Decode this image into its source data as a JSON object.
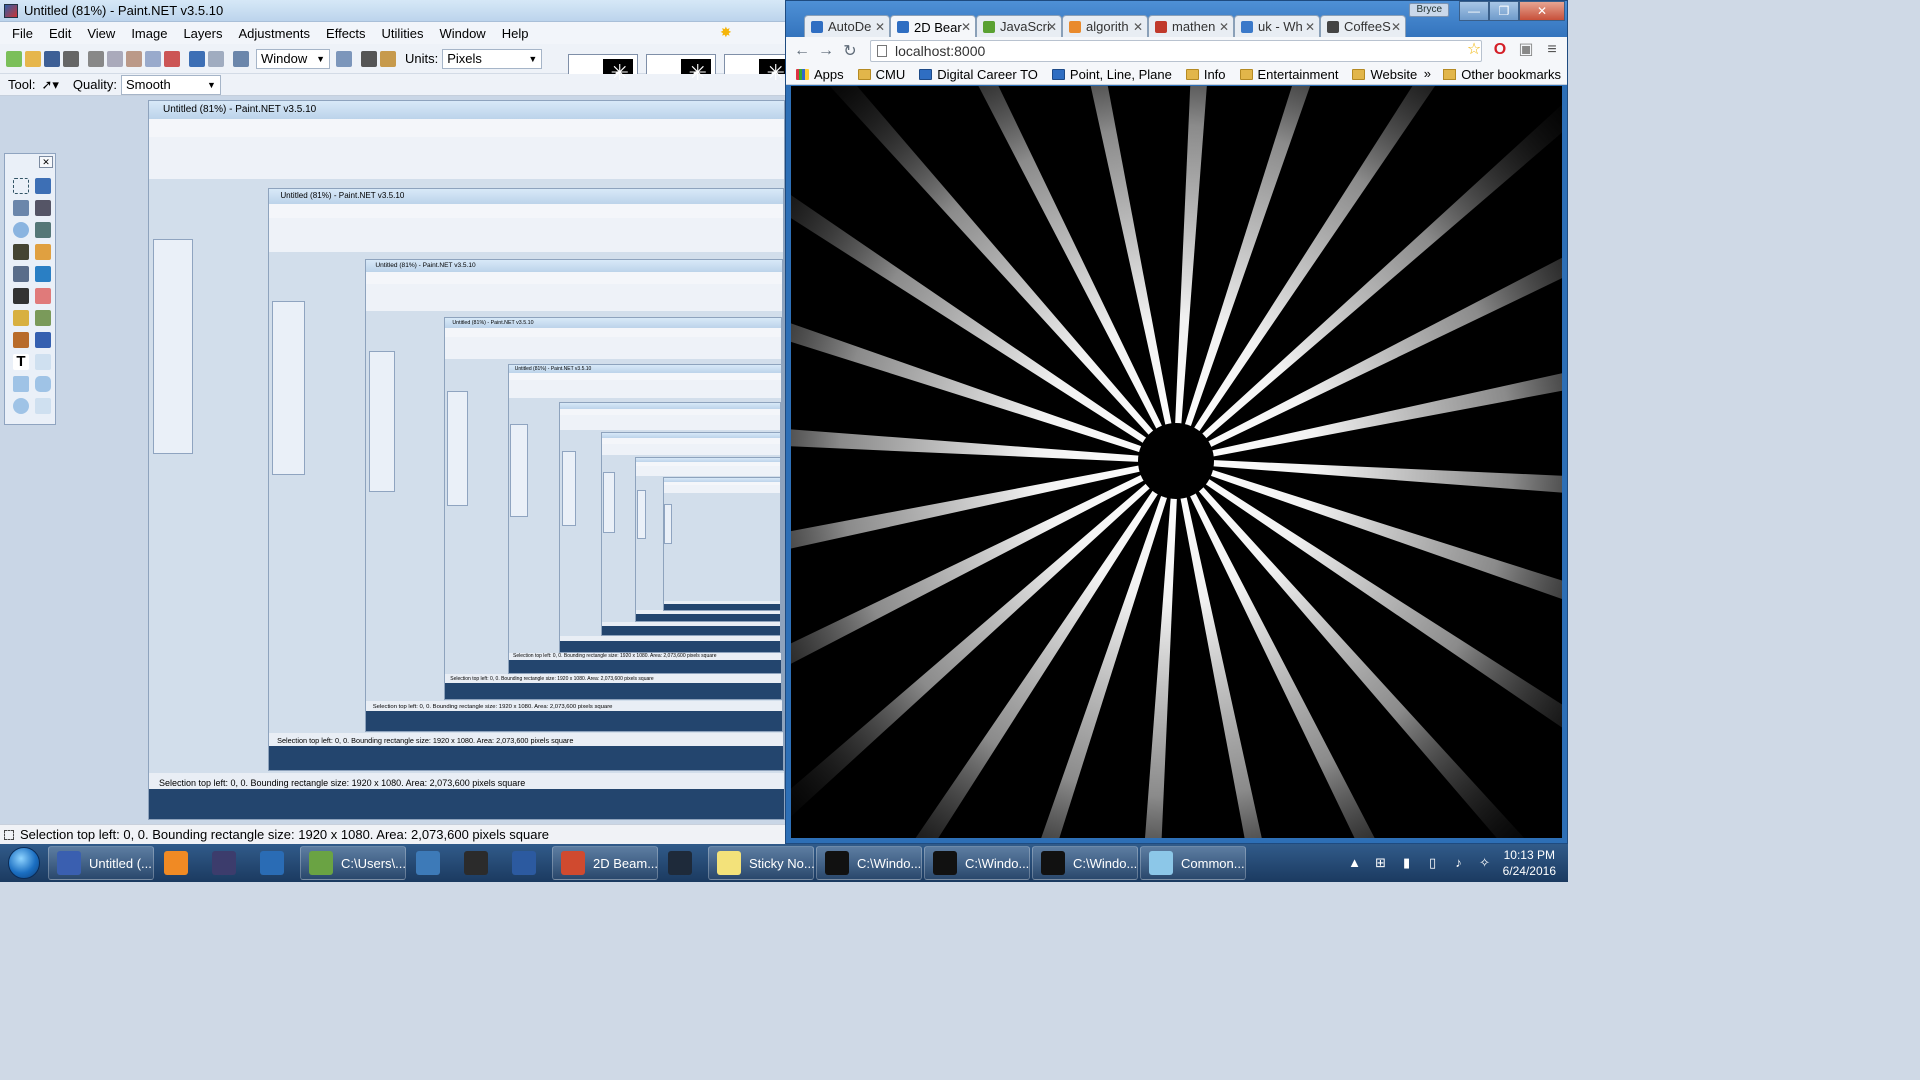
{
  "paintnet": {
    "title": "Untitled (81%) - Paint.NET v3.5.10",
    "menu": [
      "File",
      "Edit",
      "View",
      "Image",
      "Layers",
      "Adjustments",
      "Effects",
      "Utilities",
      "Window",
      "Help"
    ],
    "toolbar": {
      "window_select": "Window",
      "units_label": "Units:",
      "units_select": "Pixels",
      "tool_label": "Tool:",
      "quality_label": "Quality:",
      "quality_select": "Smooth"
    },
    "status": "Selection top left: 0, 0. Bounding rectangle size: 1920 x 1080. Area: 2,073,600 pixels square"
  },
  "chrome": {
    "tabs": [
      {
        "label": "AutoDe",
        "color": "#2f6ec2"
      },
      {
        "label": "2D Bear",
        "color": "#2f6ec2",
        "active": true
      },
      {
        "label": "JavaScri",
        "color": "#5aa132"
      },
      {
        "label": "algorith",
        "color": "#e98a2c"
      },
      {
        "label": "mathen",
        "color": "#c0392b"
      },
      {
        "label": "uk - Wh",
        "color": "#3b79c9"
      },
      {
        "label": "CoffeeS",
        "color": "#444444"
      }
    ],
    "user_badge": "Bryce",
    "url": "localhost:8000",
    "bookmarks": [
      {
        "label": "Apps",
        "type": "apps"
      },
      {
        "label": "CMU",
        "type": "folder"
      },
      {
        "label": "Digital Career TO",
        "type": "page"
      },
      {
        "label": "Point, Line, Plane",
        "type": "page"
      },
      {
        "label": "Info",
        "type": "folder"
      },
      {
        "label": "Entertainment",
        "type": "folder"
      },
      {
        "label": "Website",
        "type": "folder"
      }
    ],
    "other_bookmarks": "Other bookmarks",
    "overflow": "»"
  },
  "taskbar": {
    "items": [
      {
        "label": "Untitled (...",
        "color": "#3a5fb0",
        "open": true
      },
      {
        "label": "",
        "color": "#f08a24",
        "open": false
      },
      {
        "label": "",
        "color": "#3c3c6c",
        "open": false
      },
      {
        "label": "",
        "color": "#2a6cb5",
        "open": false
      },
      {
        "label": "C:\\Users\\...",
        "color": "#6aa343",
        "open": true
      },
      {
        "label": "",
        "color": "#3d7ab8",
        "open": false
      },
      {
        "label": "",
        "color": "#2b2b2b",
        "open": false
      },
      {
        "label": "",
        "color": "#2c5aa0",
        "open": false
      },
      {
        "label": "2D Beam...",
        "color": "#d04a2f",
        "open": true
      },
      {
        "label": "",
        "color": "#1e2a3a",
        "open": false
      },
      {
        "label": "Sticky No...",
        "color": "#f3e27a",
        "open": true
      },
      {
        "label": "C:\\Windo...",
        "color": "#111111",
        "open": true
      },
      {
        "label": "C:\\Windo...",
        "color": "#111111",
        "open": true
      },
      {
        "label": "C:\\Windo...",
        "color": "#111111",
        "open": true
      },
      {
        "label": "Common...",
        "color": "#8cc7e8",
        "open": true
      }
    ],
    "time": "10:13 PM",
    "date": "6/24/2016"
  }
}
